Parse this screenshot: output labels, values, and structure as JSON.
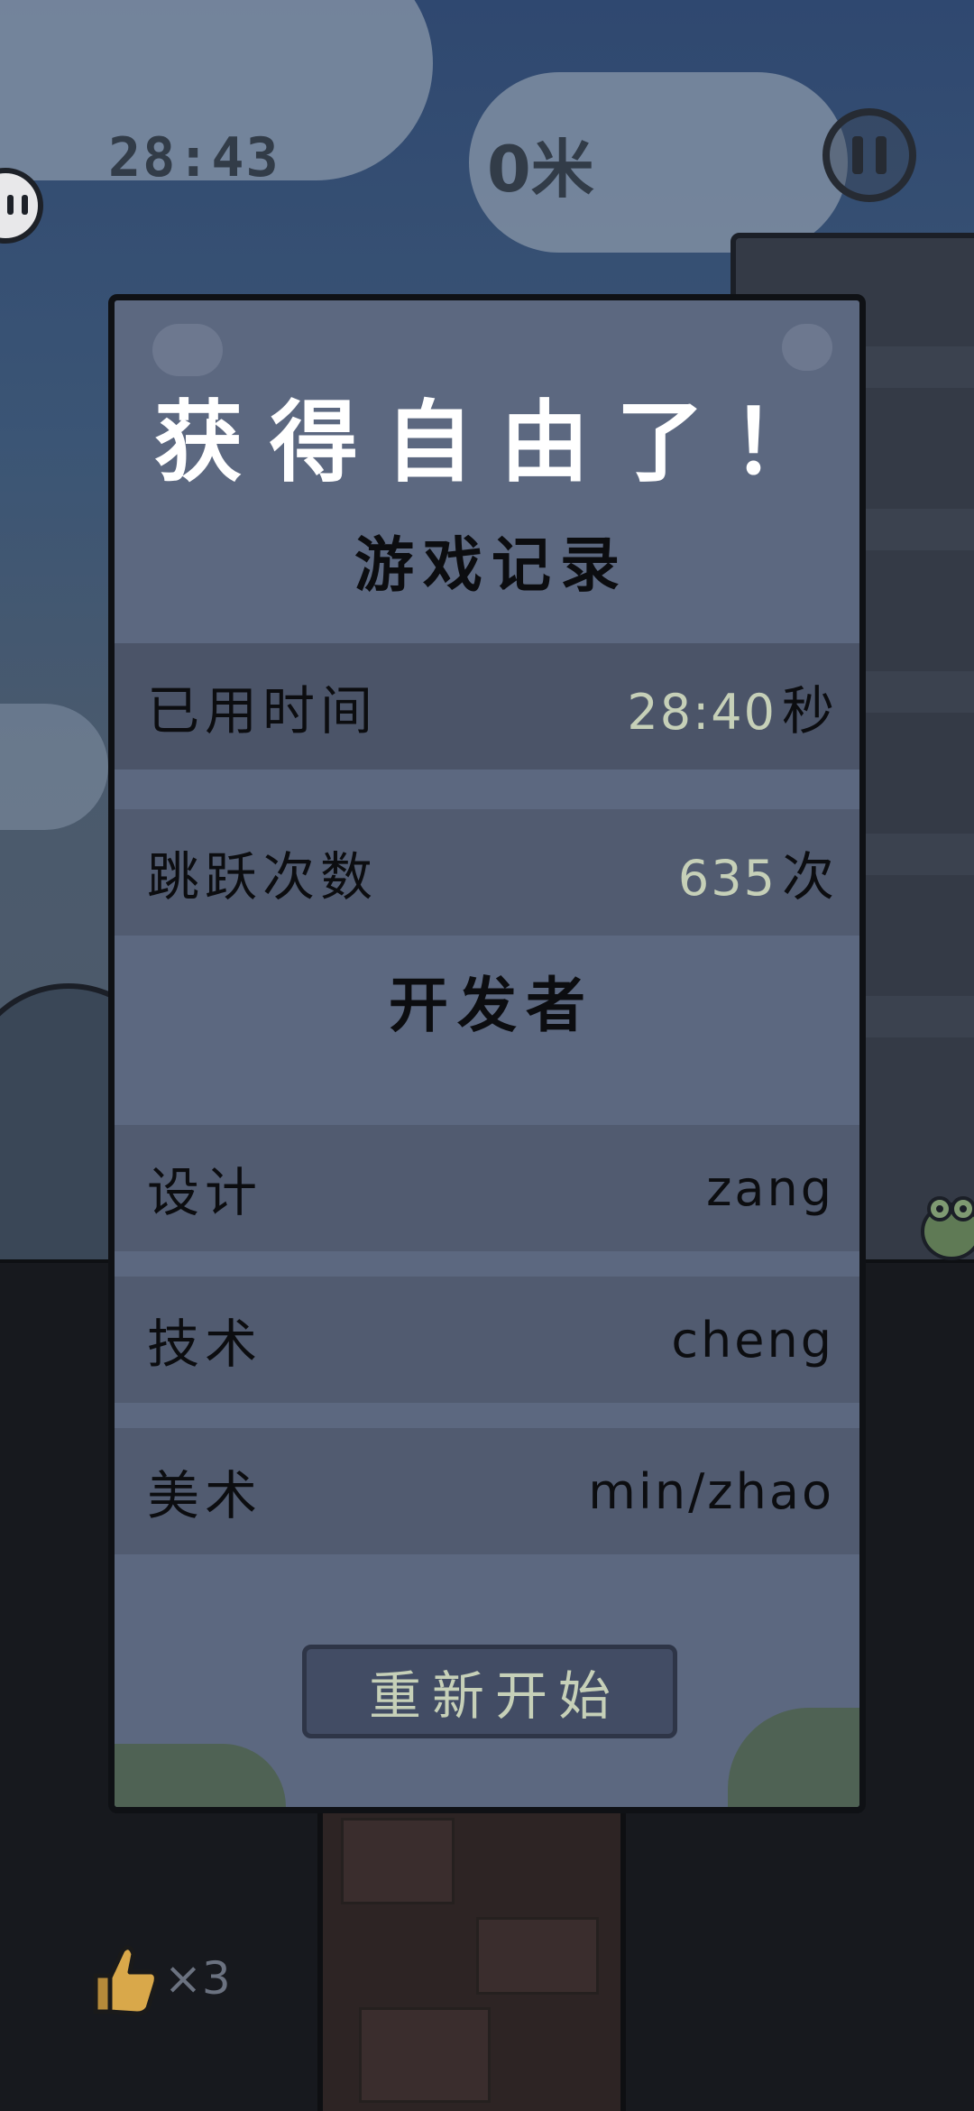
{
  "hud": {
    "time": "28:43",
    "distance": "0米",
    "lives_count": "×3"
  },
  "dialog": {
    "title": "获得自由了！",
    "records_heading": "游戏记录",
    "stats": [
      {
        "label": "已用时间",
        "value": "28:40",
        "unit": "秒"
      },
      {
        "label": "跳跃次数",
        "value": "635",
        "unit": "次"
      }
    ],
    "developers_heading": "开发者",
    "developers": [
      {
        "role": "设计",
        "name": "zang"
      },
      {
        "role": "技术",
        "name": "cheng"
      },
      {
        "role": "美术",
        "name": "min/zhao"
      }
    ],
    "restart_label": "重新开始"
  },
  "colors": {
    "dialog_bg": "#5c6880",
    "row_bg": "#515b70",
    "value_text": "#c6d0b8",
    "title_text": "#ffffff"
  }
}
